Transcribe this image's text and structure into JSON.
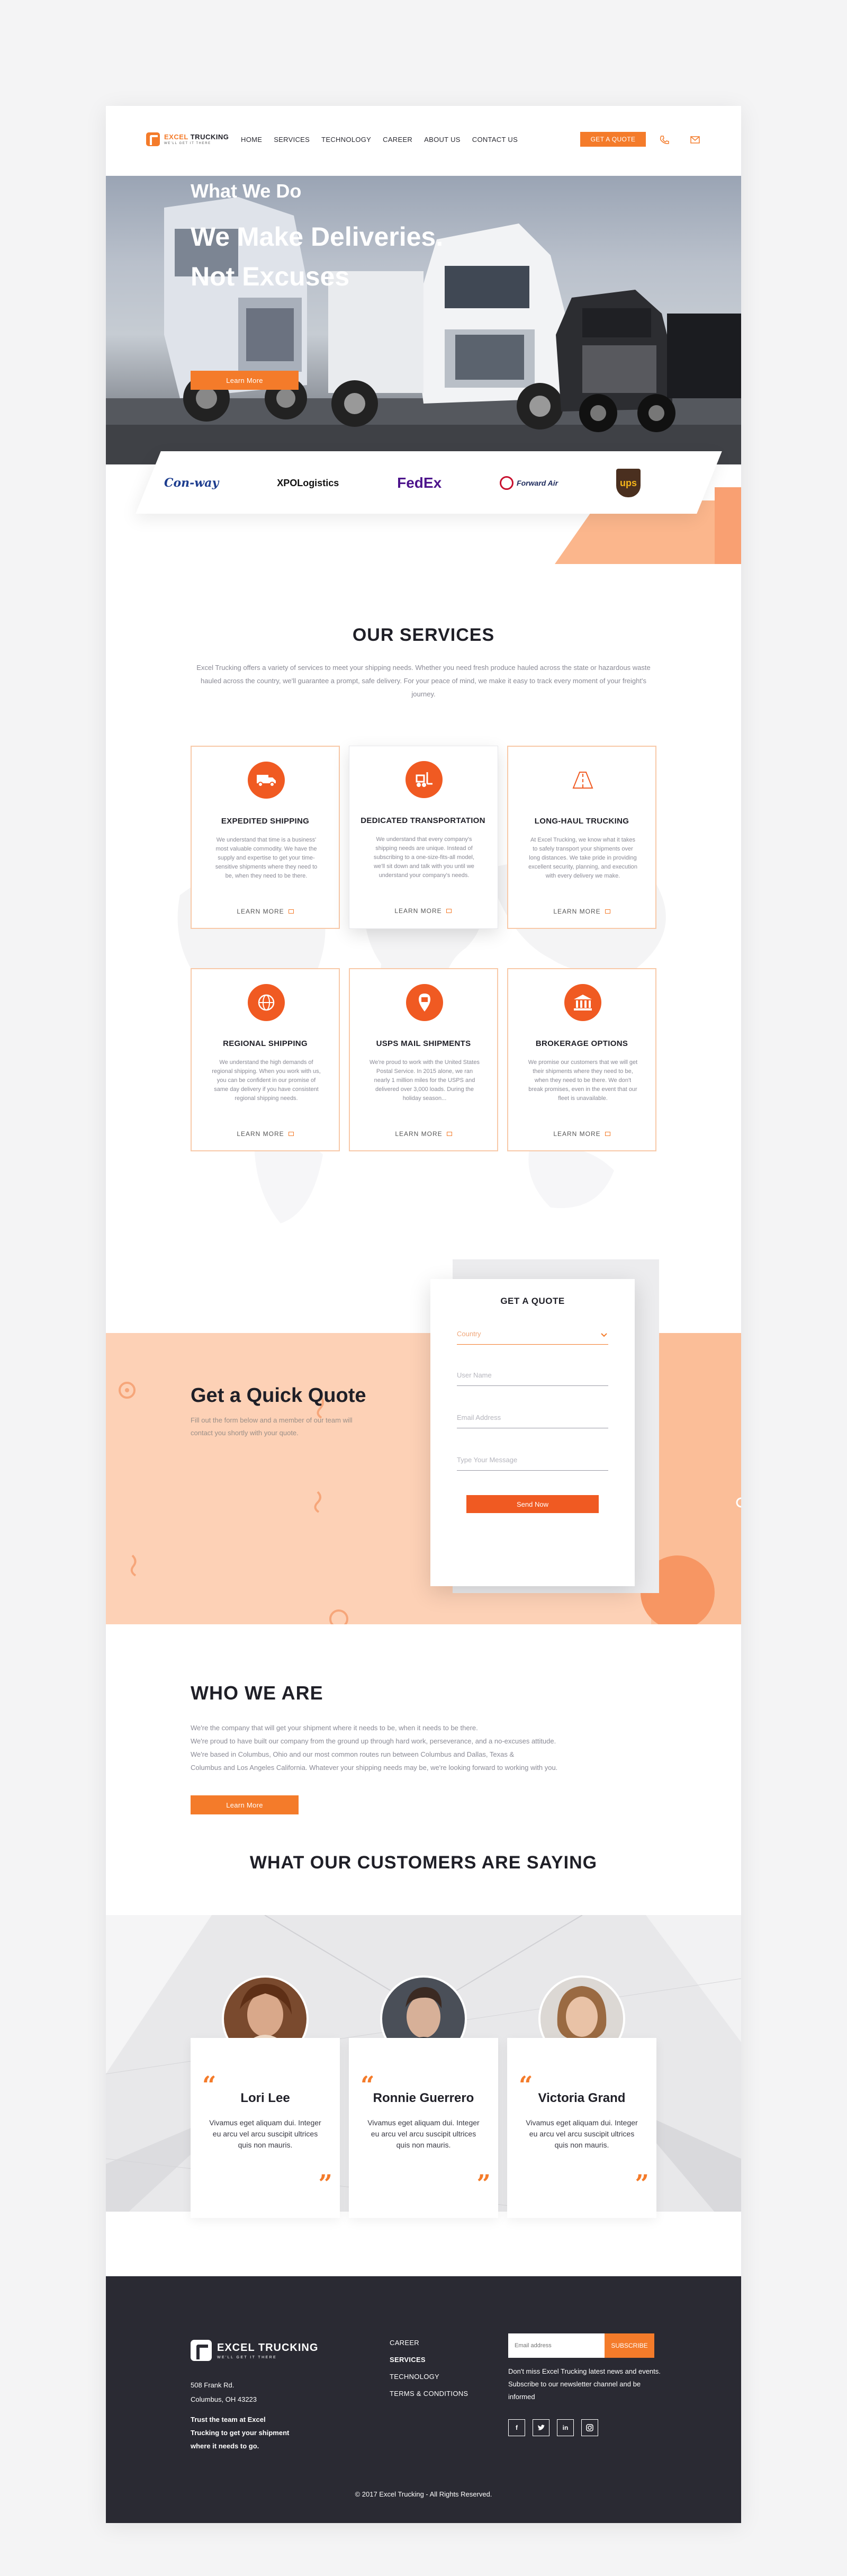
{
  "brand": {
    "name_part1": "EXCEL",
    "name_part2": "TRUCKING",
    "tagline": "WE'LL GET IT THERE"
  },
  "nav": {
    "items": [
      "HOME",
      "SERVICES",
      "TECHNOLOGY",
      "CAREER",
      "ABOUT US",
      "CONTACT US"
    ],
    "cta": "GET A QUOTE",
    "icons": [
      "phone-icon",
      "mail-icon"
    ]
  },
  "hero": {
    "subtitle": "What  We Do",
    "title": "We Make Deliveries.\nNot Excuses",
    "button": "Learn More"
  },
  "partners": [
    "Con-way",
    "XPOLogistics",
    "FedEx",
    "Forward Air",
    "ups"
  ],
  "services": {
    "title": "OUR SERVICES",
    "description": "Excel Trucking offers a variety of services to meet your shipping needs. Whether you need fresh produce hauled across the state or hazardous waste hauled across the country, we'll guarantee a prompt, safe delivery. For your peace of mind, we make it easy to track every moment of your freight's journey.",
    "more_label": "LEARN MORE",
    "cards": [
      {
        "title": "EXPEDITED SHIPPING",
        "text": "We understand that time is a business' most valuable commodity. We have the supply and expertise to get your time-sensitive shipments where they need to be, when they need to be there.",
        "icon": "truck-icon"
      },
      {
        "title": "DEDICATED TRANSPORTATION",
        "text": "We understand that every company's shipping needs are unique. Instead of subscribing to a one-size-fits-all model, we'll sit down and talk with you until we understand your company's needs.",
        "icon": "forklift-icon"
      },
      {
        "title": "LONG-HAUL TRUCKING",
        "text": "At Excel Trucking, we know what it takes to safely transport your shipments over long distances. We take pride in providing excellent security, planning, and execution with every delivery we make.",
        "icon": "road-icon"
      },
      {
        "title": "REGIONAL SHIPPING",
        "text": "We understand the high demands of regional shipping. When you work with us, you can be confident in our promise of same day delivery if you have consistent regional shipping needs.",
        "icon": "globe-icon"
      },
      {
        "title": "USPS MAIL SHIPMENTS",
        "text": "We're proud to work with the United States Postal Service. In 2015 alone, we ran nearly 1 million miles for the USPS and delivered over 3,000 loads. During the holiday season...",
        "icon": "mail-shipment-icon"
      },
      {
        "title": "BROKERAGE OPTIONS",
        "text": "We promise our customers that we will get their shipments where they need to be, when they need to be there. We don't break promises, even in the event that our fleet is unavailable.",
        "icon": "bank-icon"
      }
    ]
  },
  "quote": {
    "title": "Get a Quick Quote",
    "text": "Fill out the form below and a member of our team will contact you shortly with your quote.",
    "form_title": "GET A QUOTE",
    "country_placeholder": "Country",
    "name_placeholder": "User Name",
    "email_placeholder": "Email Address",
    "message_placeholder": "Type Your Message",
    "send": "Send Now"
  },
  "who": {
    "title": "WHO WE ARE",
    "lines": [
      "We're the company that will get your shipment where it needs to be, when it needs to be there.",
      "We're proud to have built our company from the ground up through hard work, perseverance, and a no-excuses attitude.",
      "We're based in Columbus, Ohio and our most common routes run between Columbus and Dallas, Texas &",
      "Columbus and Los Angeles California. Whatever your shipping needs may be, we're looking forward to working with you."
    ],
    "button": "Learn More"
  },
  "testimonials": {
    "title": "WHAT OUR CUSTOMERS ARE SAYING",
    "items": [
      {
        "name": "Lori Lee",
        "quote": "Vivamus eget aliquam dui. Integer eu arcu vel arcu suscipit ultrices quis non mauris."
      },
      {
        "name": "Ronnie Guerrero",
        "quote": "Vivamus eget aliquam dui. Integer eu arcu vel arcu suscipit ultrices quis non mauris."
      },
      {
        "name": "Victoria Grand",
        "quote": "Vivamus eget aliquam dui. Integer eu arcu vel arcu suscipit ultrices quis non mauris."
      }
    ]
  },
  "footer": {
    "name": "EXCEL TRUCKING",
    "tagline": "WE'LL GET IT THERE",
    "address1": "508 Frank Rd.",
    "address2": "Columbus, OH 43223",
    "trust": "Trust the team at Excel Trucking to get your shipment where it needs to go.",
    "links": [
      "CAREER",
      "SERVICES",
      "TECHNOLOGY",
      "TERMS & CONDITIONS"
    ],
    "email_placeholder": "Email address",
    "subscribe": "SUBSCRIBE",
    "newsletter": "Don't miss Excel Trucking latest news and events. Subscribe to our newsletter channel and be informed",
    "social": [
      "facebook-icon",
      "twitter-icon",
      "linkedin-icon",
      "instagram-icon"
    ],
    "copyright": "© 2017 Excel Trucking -  All Rights Reserved."
  },
  "colors": {
    "accent": "#f47b2a",
    "accent_dark": "#f05a22",
    "peach": "#fdd1b6",
    "footer_bg": "#2a2a33"
  }
}
